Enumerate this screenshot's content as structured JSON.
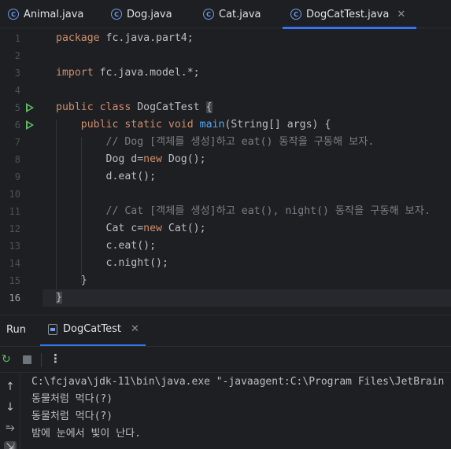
{
  "tabs": [
    {
      "label": "Animal.java",
      "icon": "class-icon",
      "active": false
    },
    {
      "label": "Dog.java",
      "icon": "class-icon",
      "active": false
    },
    {
      "label": "Cat.java",
      "icon": "class-icon",
      "active": false
    },
    {
      "label": "DogCatTest.java",
      "icon": "class-icon",
      "active": true
    }
  ],
  "tab_close_glyph": "✕",
  "class_icon_letter": "C",
  "editor": {
    "current_line": 16,
    "line_numbers": [
      "1",
      "2",
      "3",
      "4",
      "5",
      "6",
      "7",
      "8",
      "9",
      "10",
      "11",
      "12",
      "13",
      "14",
      "15",
      "16"
    ],
    "lines": [
      [
        {
          "t": "package",
          "c": "kw"
        },
        {
          "t": " fc.java.part4;",
          "c": ""
        }
      ],
      [],
      [
        {
          "t": "import",
          "c": "kw"
        },
        {
          "t": " fc.java.model.*;",
          "c": ""
        }
      ],
      [],
      [
        {
          "t": "public class",
          "c": "kw"
        },
        {
          "t": " DogCatTest ",
          "c": ""
        },
        {
          "t": "{",
          "c": "brace"
        }
      ],
      [
        {
          "t": "    ",
          "c": ""
        },
        {
          "t": "public static void",
          "c": "kw"
        },
        {
          "t": " ",
          "c": ""
        },
        {
          "t": "main",
          "c": "fn"
        },
        {
          "t": "(String[] args) {",
          "c": ""
        }
      ],
      [
        {
          "t": "        ",
          "c": ""
        },
        {
          "t": "// Dog [객체를 생성]하고 eat() 동작을 구동해 보자.",
          "c": "cm"
        }
      ],
      [
        {
          "t": "        Dog d=",
          "c": ""
        },
        {
          "t": "new",
          "c": "kw"
        },
        {
          "t": " Dog();",
          "c": ""
        }
      ],
      [
        {
          "t": "        d.eat();",
          "c": ""
        }
      ],
      [],
      [
        {
          "t": "        ",
          "c": ""
        },
        {
          "t": "// Cat [객체를 생성]하고 eat(), night() 동작을 구동해 보자.",
          "c": "cm"
        }
      ],
      [
        {
          "t": "        Cat c=",
          "c": ""
        },
        {
          "t": "new",
          "c": "kw"
        },
        {
          "t": " Cat();",
          "c": ""
        }
      ],
      [
        {
          "t": "        c.eat();",
          "c": ""
        }
      ],
      [
        {
          "t": "        c.night();",
          "c": ""
        }
      ],
      [
        {
          "t": "    }",
          "c": ""
        }
      ],
      [
        {
          "t": "}",
          "c": "brace"
        }
      ]
    ],
    "run_gutter_lines": [
      5,
      6
    ]
  },
  "run_panel": {
    "title": "Run",
    "tab_label": "DogCatTest",
    "close_glyph": "✕",
    "more_glyph": "⋮",
    "rerun_glyph": "↻",
    "side_buttons": [
      "↑",
      "↓",
      "⥱",
      "⇲"
    ],
    "console": [
      "C:\\fcjava\\jdk-11\\bin\\java.exe \"-javaagent:C:\\Program Files\\JetBrain",
      "동물처럼 먹다(?)",
      "동물처럼 먹다(?)",
      "밤에 눈에서 빛이 난다."
    ]
  },
  "colors": {
    "background": "#1e1f22",
    "keyword": "#cf8e6d",
    "function": "#56a8f5",
    "comment": "#7a7e85",
    "text": "#bcbec4",
    "accent": "#3574f0",
    "run_green": "#5fb865"
  }
}
